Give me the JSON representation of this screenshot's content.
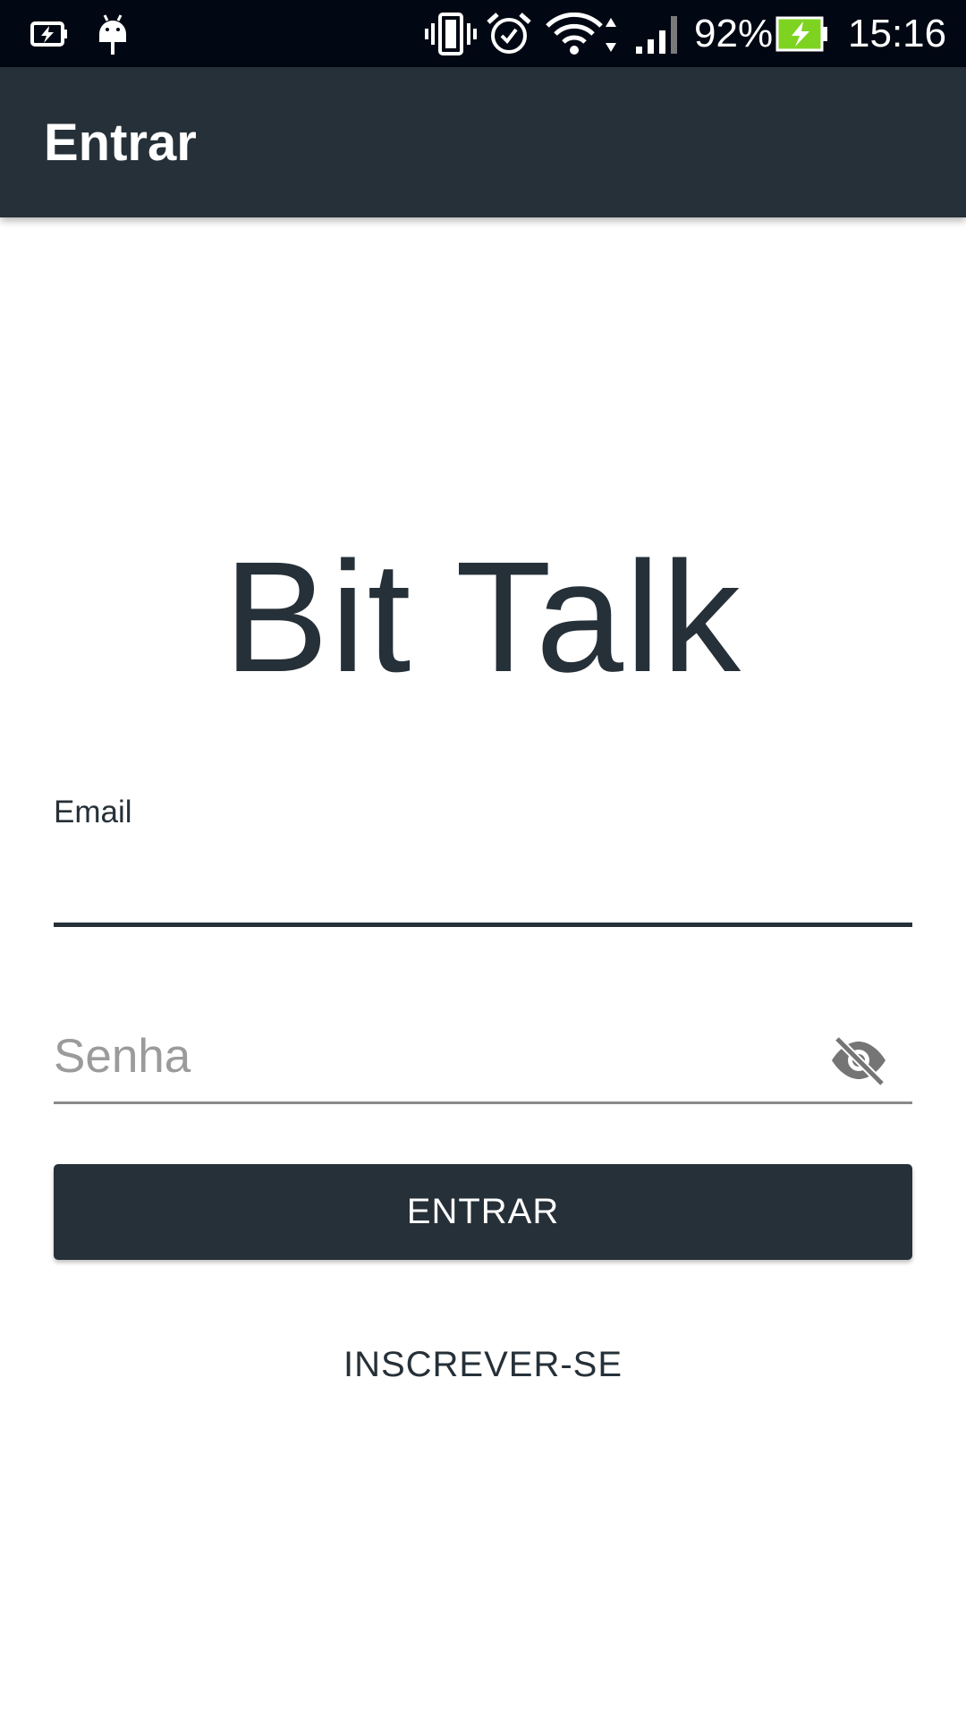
{
  "status_bar": {
    "battery_percent": "92%",
    "time": "15:16",
    "icons": [
      "battery-saver-charging-icon",
      "android-debug-icon",
      "vibrate-icon",
      "alarm-icon",
      "wifi-icon",
      "cell-signal-icon",
      "battery-charging-icon"
    ],
    "battery_level": 0.92,
    "battery_color": "#7ED321"
  },
  "app_bar": {
    "title": "Entrar",
    "background": "#263038"
  },
  "brand": {
    "name": "Bit Talk"
  },
  "form": {
    "email": {
      "label": "Email",
      "value": ""
    },
    "password": {
      "placeholder": "Senha",
      "value": "",
      "visibility_icon": "visibility-off-icon"
    },
    "login_label": "ENTRAR",
    "signup_label": "INSCREVER-SE"
  },
  "colors": {
    "primary": "#263038",
    "status_bar": "#010813",
    "placeholder": "#9b9b9b"
  }
}
